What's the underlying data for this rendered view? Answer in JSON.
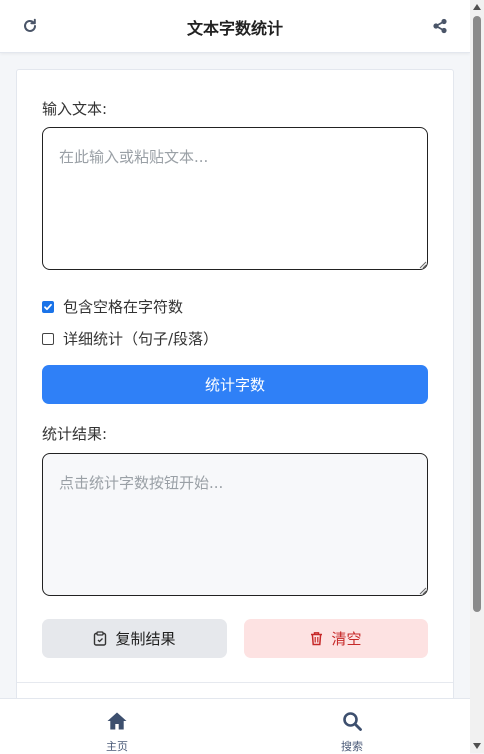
{
  "header": {
    "title": "文本字数统计",
    "left_icon": "refresh-icon",
    "right_icon": "share-icon"
  },
  "form": {
    "input_label": "输入文本:",
    "input_placeholder": "在此输入或粘贴文本...",
    "input_value": "",
    "options": [
      {
        "label": "包含空格在字符数",
        "checked": true
      },
      {
        "label": "详细统计（句子/段落）",
        "checked": false
      }
    ],
    "count_button": "统计字数",
    "result_label": "统计结果:",
    "result_placeholder": "点击统计字数按钮开始...",
    "copy_button": "复制结果",
    "clear_button": "清空"
  },
  "bottom_nav": {
    "items": [
      {
        "label": "主页",
        "icon": "home-icon"
      },
      {
        "label": "搜索",
        "icon": "search-icon"
      }
    ]
  },
  "colors": {
    "primary": "#2f80f7",
    "danger_bg": "#fde2e2",
    "danger_text": "#c62828",
    "secondary_bg": "#e6e8ec"
  }
}
